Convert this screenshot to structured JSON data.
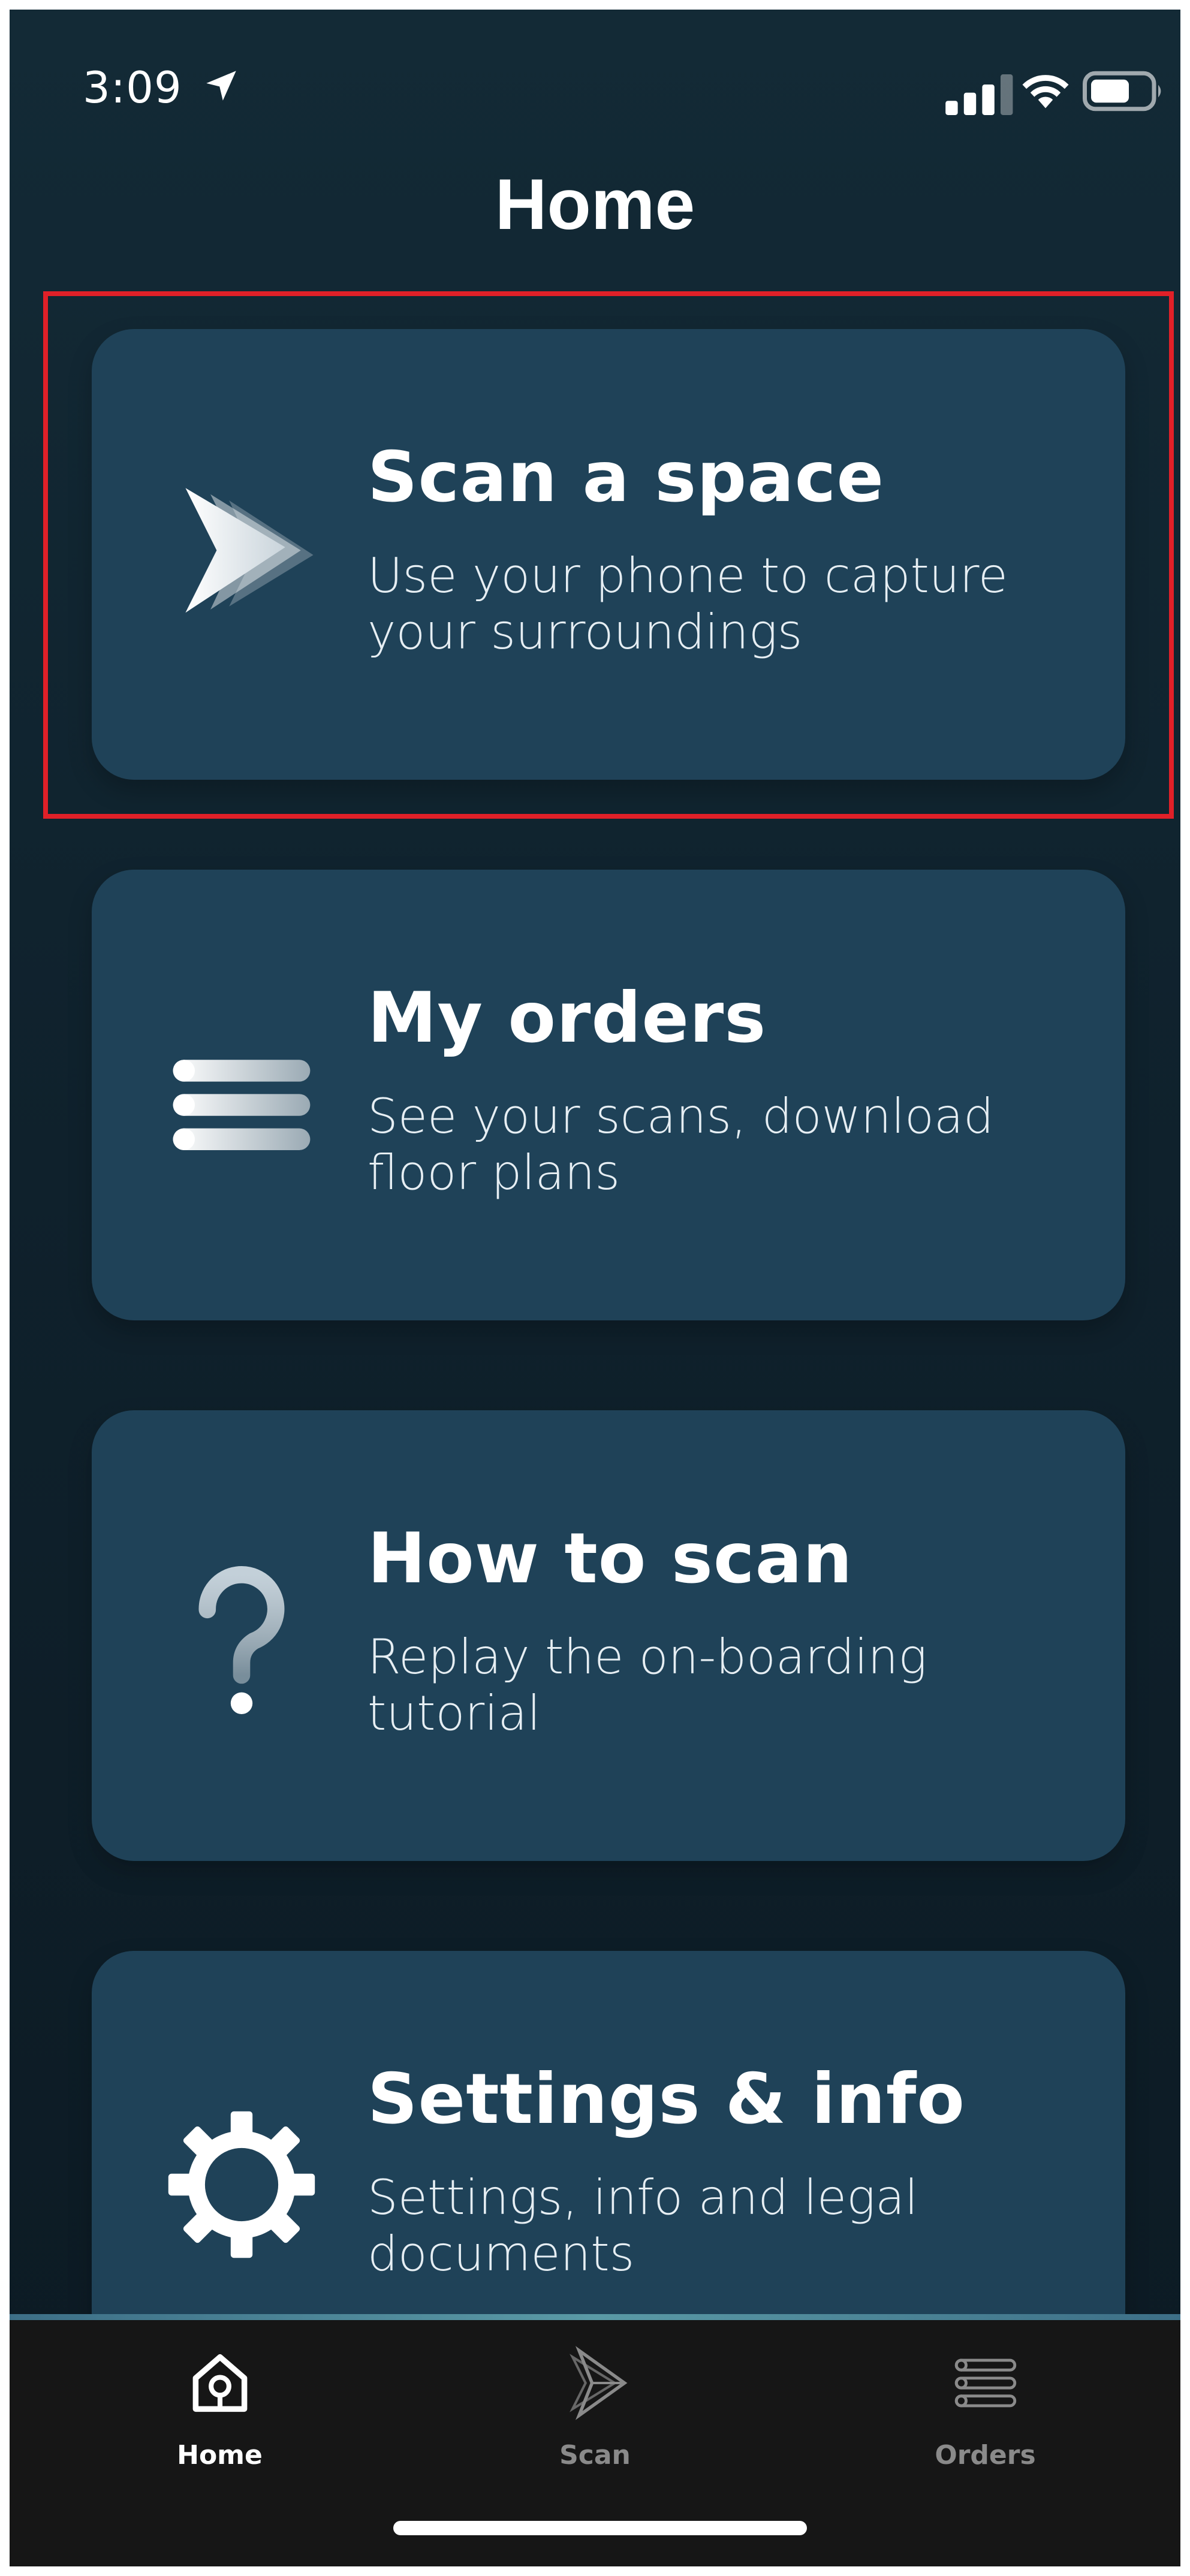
{
  "status_bar": {
    "time": "3:09",
    "icons": [
      "location-arrow-icon",
      "cellular-signal-icon",
      "wifi-icon",
      "battery-icon"
    ]
  },
  "header": {
    "title": "Home"
  },
  "cards": [
    {
      "title": "Scan a space",
      "subtitle": "Use your phone to capture your surroundings",
      "icon": "scan-play-icon",
      "highlighted": true
    },
    {
      "title": "My orders",
      "subtitle": "See your scans, download floor plans",
      "icon": "list-icon"
    },
    {
      "title": "How to scan",
      "subtitle": "Replay the on-boarding tutorial",
      "icon": "question-mark-icon"
    },
    {
      "title": "Settings & info",
      "subtitle": "Settings, info and legal documents",
      "icon": "gear-icon"
    }
  ],
  "tab_bar": {
    "tabs": [
      {
        "label": "Home",
        "icon": "home-icon",
        "active": true
      },
      {
        "label": "Scan",
        "icon": "scan-icon",
        "active": false
      },
      {
        "label": "Orders",
        "icon": "orders-icon",
        "active": false
      }
    ]
  },
  "colors": {
    "background": "#0f212c",
    "card": "#1f4258",
    "highlight_border": "#e02028",
    "tab_active": "#ffffff",
    "tab_inactive": "#8a8a8a"
  }
}
